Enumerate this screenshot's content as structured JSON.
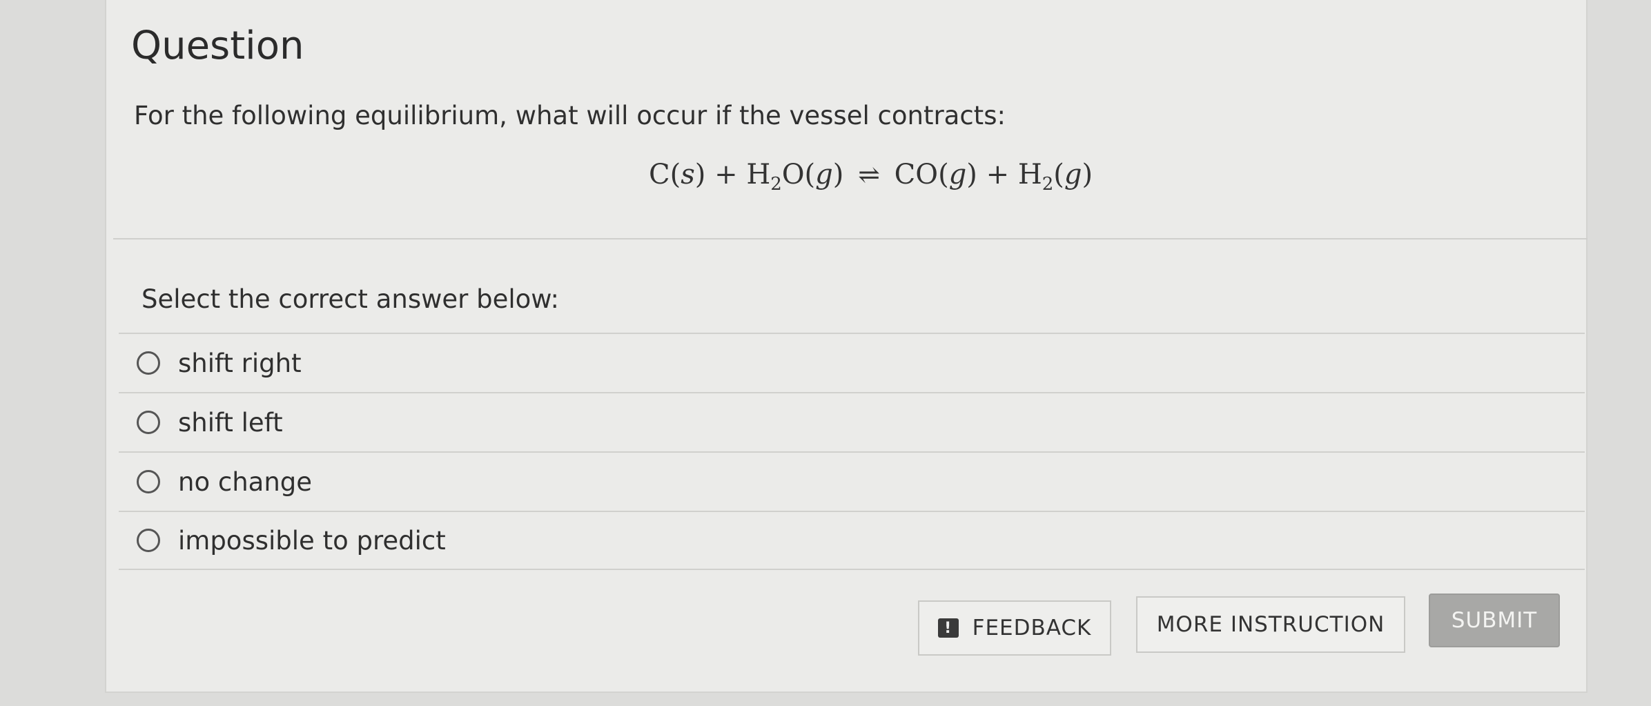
{
  "header": {
    "title": "Question"
  },
  "question": {
    "prompt": "For the following equilibrium, what will occur if the vessel contracts:",
    "equation": {
      "reactant1": "C",
      "reactant1_state": "s",
      "reactant2_base": "H",
      "reactant2_sub": "2",
      "reactant2_rest": "O",
      "reactant2_state": "g",
      "arrow": "⇌",
      "product1": "CO",
      "product1_state": "g",
      "product2_base": "H",
      "product2_sub": "2",
      "product2_state": "g",
      "plus": "+"
    }
  },
  "answers": {
    "label": "Select the correct answer below:",
    "options": [
      {
        "label": "shift right",
        "selected": false
      },
      {
        "label": "shift left",
        "selected": false
      },
      {
        "label": "no change",
        "selected": false
      },
      {
        "label": "impossible to predict",
        "selected": false
      }
    ]
  },
  "footer": {
    "feedback_label": "FEEDBACK",
    "feedback_icon": "!",
    "more_instruction_label": "MORE INSTRUCTION",
    "submit_label": "SUBMIT"
  },
  "colors": {
    "background": "#dcdcda",
    "card": "#ebebe9",
    "submit_disabled": "#a8a8a6"
  }
}
